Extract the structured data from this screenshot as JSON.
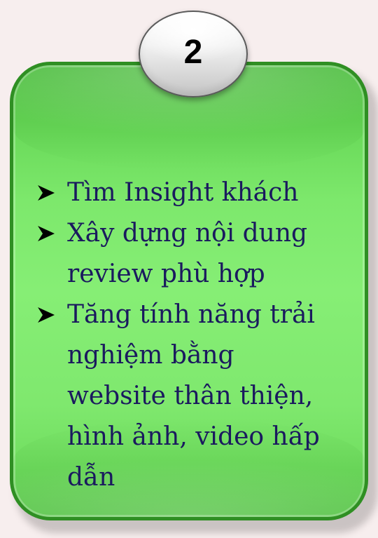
{
  "badge": {
    "number": "2"
  },
  "items": [
    {
      "text": "Tìm Insight khách"
    },
    {
      "text": "Xây dựng nội dung\nreview phù hợp"
    },
    {
      "text": "Tăng tính năng trải\nnghiệm bằng\nwebsite thân thiện,\nhình ảnh, video hấp\ndẫn"
    }
  ],
  "colors": {
    "card_fill": "#86ee75",
    "card_border": "#2f8f23",
    "text": "#1a1a5e",
    "background": "#f7eeee"
  },
  "icons": {
    "bullet": "arrow-bullet-icon"
  }
}
